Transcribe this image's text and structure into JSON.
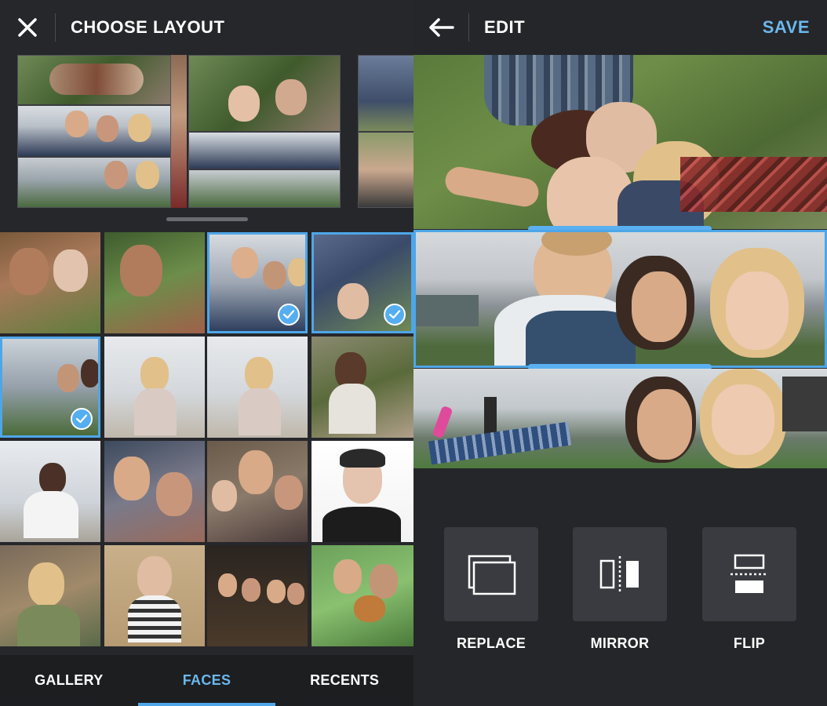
{
  "left": {
    "title": "CHOOSE LAYOUT",
    "close_icon": "close-icon",
    "tabs": [
      {
        "label": "GALLERY",
        "active": false
      },
      {
        "label": "FACES",
        "active": true
      },
      {
        "label": "RECENTS",
        "active": false
      }
    ],
    "photos_selected": [
      3,
      4,
      5
    ]
  },
  "right": {
    "title": "EDIT",
    "back_icon": "arrow-left-icon",
    "save_label": "SAVE",
    "tools": [
      {
        "label": "REPLACE",
        "icon": "replace-icon"
      },
      {
        "label": "MIRROR",
        "icon": "mirror-icon"
      },
      {
        "label": "FLIP",
        "icon": "flip-icon"
      }
    ]
  },
  "colors": {
    "accent": "#4ea6e8",
    "background": "#26272b",
    "tool_bg": "#3a3b40"
  }
}
